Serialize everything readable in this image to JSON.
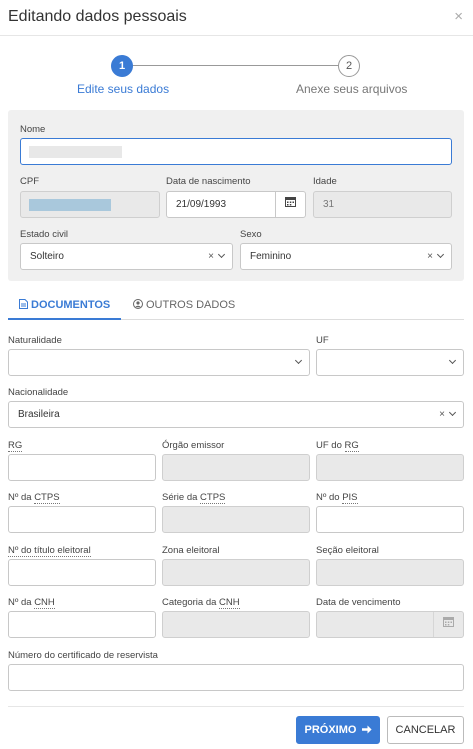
{
  "dialog": {
    "title": "Editando dados pessoais",
    "close_icon": "×"
  },
  "stepper": {
    "steps": [
      {
        "number": "1",
        "label": "Edite seus dados",
        "active": true
      },
      {
        "number": "2",
        "label": "Anexe seus arquivos",
        "active": false
      }
    ]
  },
  "personal": {
    "nome": {
      "label": "Nome",
      "value": ""
    },
    "cpf": {
      "label": "CPF",
      "value": ""
    },
    "nascimento": {
      "label": "Data de nascimento",
      "value": "21/09/1993"
    },
    "idade": {
      "label": "Idade",
      "value": "31"
    },
    "estado_civil": {
      "label": "Estado civil",
      "value": "Solteiro"
    },
    "sexo": {
      "label": "Sexo",
      "value": "Feminino"
    }
  },
  "tabs": [
    {
      "label": "DOCUMENTOS",
      "icon": "document-icon",
      "active": true
    },
    {
      "label": "OUTROS DADOS",
      "icon": "user-circle-icon",
      "active": false
    }
  ],
  "documents": {
    "naturalidade": {
      "label": "Naturalidade",
      "value": ""
    },
    "uf": {
      "label": "UF",
      "value": ""
    },
    "nacionalidade": {
      "label": "Nacionalidade",
      "value": "Brasileira"
    },
    "rg": {
      "label": "RG",
      "value": ""
    },
    "orgao_emissor": {
      "label": "Órgão emissor",
      "value": ""
    },
    "uf_rg": {
      "label_prefix": "UF do ",
      "label_abbr": "RG",
      "value": ""
    },
    "ctps_numero": {
      "label_prefix": "Nº da ",
      "label_abbr": "CTPS",
      "value": ""
    },
    "ctps_serie": {
      "label_prefix": "Série da ",
      "label_abbr": "CTPS",
      "value": ""
    },
    "pis": {
      "label_prefix": "Nº do ",
      "label_abbr": "PIS",
      "value": ""
    },
    "titulo": {
      "label": "Nº do título eleitoral",
      "value": ""
    },
    "zona": {
      "label": "Zona eleitoral",
      "value": ""
    },
    "secao": {
      "label": "Seção eleitoral",
      "value": ""
    },
    "cnh": {
      "label_prefix": "Nº da ",
      "label_abbr": "CNH",
      "value": ""
    },
    "cnh_categoria": {
      "label_prefix": "Categoria da ",
      "label_abbr": "CNH",
      "value": ""
    },
    "cnh_vencimento": {
      "label": "Data de vencimento",
      "value": ""
    },
    "reservista": {
      "label": "Número do certificado de reservista",
      "value": ""
    }
  },
  "footer": {
    "next_label": "PRÓXIMO",
    "cancel_label": "CANCELAR"
  },
  "colors": {
    "accent": "#3a7bd5",
    "panel_bg": "#f0f0f0",
    "disabled_bg": "#e9e9e9"
  }
}
